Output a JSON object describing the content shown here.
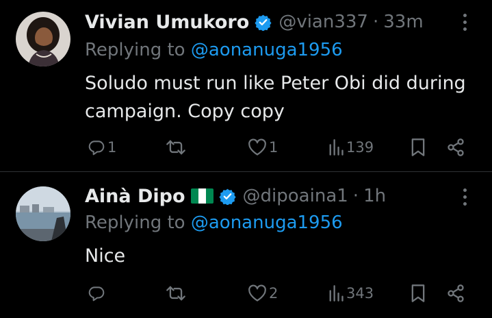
{
  "tweets": [
    {
      "name": "Vivian Umukoro",
      "handle": "@vian337",
      "separator": "·",
      "time": "33m",
      "replying_prefix": "Replying to ",
      "replying_to": "@aonanuga1956",
      "text": "Soludo must run like Peter Obi did during campaign. Copy copy",
      "replies": "1",
      "retweets": "",
      "likes": "1",
      "views": "139",
      "verified": true,
      "has_flag": false
    },
    {
      "name": "Ainà Dipo",
      "handle": "@dipoaina1",
      "separator": "·",
      "time": "1h",
      "replying_prefix": "Replying to ",
      "replying_to": "@aonanuga1956",
      "text": "Nice",
      "replies": "",
      "retweets": "",
      "likes": "2",
      "views": "343",
      "verified": true,
      "has_flag": true
    }
  ],
  "colors": {
    "background": "#000000",
    "text": "#e7e9ea",
    "muted": "#71767b",
    "accent": "#1d9bf0",
    "divider": "#2f3336",
    "flag_green": "#008751"
  },
  "icons": [
    "verified-badge-icon",
    "nigeria-flag-icon",
    "more-icon",
    "reply-icon",
    "retweet-icon",
    "like-icon",
    "views-icon",
    "bookmark-icon",
    "share-icon"
  ]
}
